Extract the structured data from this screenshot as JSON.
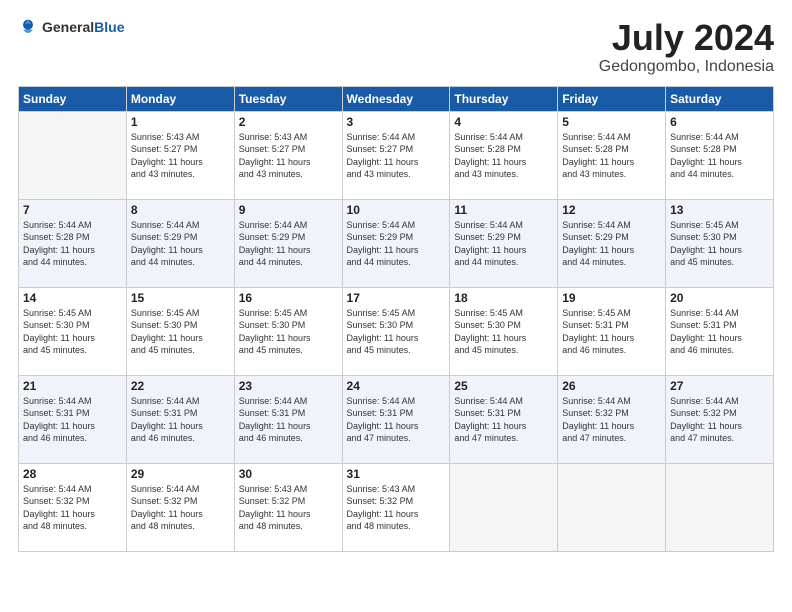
{
  "header": {
    "logo_general": "General",
    "logo_blue": "Blue",
    "title": "July 2024",
    "subtitle": "Gedongombo, Indonesia"
  },
  "days_of_week": [
    "Sunday",
    "Monday",
    "Tuesday",
    "Wednesday",
    "Thursday",
    "Friday",
    "Saturday"
  ],
  "weeks": [
    {
      "days": [
        {
          "num": "",
          "sunrise": "",
          "sunset": "",
          "daylight": "",
          "minutes": ""
        },
        {
          "num": "1",
          "sunrise": "Sunrise: 5:43 AM",
          "sunset": "Sunset: 5:27 PM",
          "daylight": "Daylight: 11 hours",
          "minutes": "and 43 minutes."
        },
        {
          "num": "2",
          "sunrise": "Sunrise: 5:43 AM",
          "sunset": "Sunset: 5:27 PM",
          "daylight": "Daylight: 11 hours",
          "minutes": "and 43 minutes."
        },
        {
          "num": "3",
          "sunrise": "Sunrise: 5:44 AM",
          "sunset": "Sunset: 5:27 PM",
          "daylight": "Daylight: 11 hours",
          "minutes": "and 43 minutes."
        },
        {
          "num": "4",
          "sunrise": "Sunrise: 5:44 AM",
          "sunset": "Sunset: 5:28 PM",
          "daylight": "Daylight: 11 hours",
          "minutes": "and 43 minutes."
        },
        {
          "num": "5",
          "sunrise": "Sunrise: 5:44 AM",
          "sunset": "Sunset: 5:28 PM",
          "daylight": "Daylight: 11 hours",
          "minutes": "and 43 minutes."
        },
        {
          "num": "6",
          "sunrise": "Sunrise: 5:44 AM",
          "sunset": "Sunset: 5:28 PM",
          "daylight": "Daylight: 11 hours",
          "minutes": "and 44 minutes."
        }
      ]
    },
    {
      "days": [
        {
          "num": "7",
          "sunrise": "Sunrise: 5:44 AM",
          "sunset": "Sunset: 5:28 PM",
          "daylight": "Daylight: 11 hours",
          "minutes": "and 44 minutes."
        },
        {
          "num": "8",
          "sunrise": "Sunrise: 5:44 AM",
          "sunset": "Sunset: 5:29 PM",
          "daylight": "Daylight: 11 hours",
          "minutes": "and 44 minutes."
        },
        {
          "num": "9",
          "sunrise": "Sunrise: 5:44 AM",
          "sunset": "Sunset: 5:29 PM",
          "daylight": "Daylight: 11 hours",
          "minutes": "and 44 minutes."
        },
        {
          "num": "10",
          "sunrise": "Sunrise: 5:44 AM",
          "sunset": "Sunset: 5:29 PM",
          "daylight": "Daylight: 11 hours",
          "minutes": "and 44 minutes."
        },
        {
          "num": "11",
          "sunrise": "Sunrise: 5:44 AM",
          "sunset": "Sunset: 5:29 PM",
          "daylight": "Daylight: 11 hours",
          "minutes": "and 44 minutes."
        },
        {
          "num": "12",
          "sunrise": "Sunrise: 5:44 AM",
          "sunset": "Sunset: 5:29 PM",
          "daylight": "Daylight: 11 hours",
          "minutes": "and 44 minutes."
        },
        {
          "num": "13",
          "sunrise": "Sunrise: 5:45 AM",
          "sunset": "Sunset: 5:30 PM",
          "daylight": "Daylight: 11 hours",
          "minutes": "and 45 minutes."
        }
      ]
    },
    {
      "days": [
        {
          "num": "14",
          "sunrise": "Sunrise: 5:45 AM",
          "sunset": "Sunset: 5:30 PM",
          "daylight": "Daylight: 11 hours",
          "minutes": "and 45 minutes."
        },
        {
          "num": "15",
          "sunrise": "Sunrise: 5:45 AM",
          "sunset": "Sunset: 5:30 PM",
          "daylight": "Daylight: 11 hours",
          "minutes": "and 45 minutes."
        },
        {
          "num": "16",
          "sunrise": "Sunrise: 5:45 AM",
          "sunset": "Sunset: 5:30 PM",
          "daylight": "Daylight: 11 hours",
          "minutes": "and 45 minutes."
        },
        {
          "num": "17",
          "sunrise": "Sunrise: 5:45 AM",
          "sunset": "Sunset: 5:30 PM",
          "daylight": "Daylight: 11 hours",
          "minutes": "and 45 minutes."
        },
        {
          "num": "18",
          "sunrise": "Sunrise: 5:45 AM",
          "sunset": "Sunset: 5:30 PM",
          "daylight": "Daylight: 11 hours",
          "minutes": "and 45 minutes."
        },
        {
          "num": "19",
          "sunrise": "Sunrise: 5:45 AM",
          "sunset": "Sunset: 5:31 PM",
          "daylight": "Daylight: 11 hours",
          "minutes": "and 46 minutes."
        },
        {
          "num": "20",
          "sunrise": "Sunrise: 5:44 AM",
          "sunset": "Sunset: 5:31 PM",
          "daylight": "Daylight: 11 hours",
          "minutes": "and 46 minutes."
        }
      ]
    },
    {
      "days": [
        {
          "num": "21",
          "sunrise": "Sunrise: 5:44 AM",
          "sunset": "Sunset: 5:31 PM",
          "daylight": "Daylight: 11 hours",
          "minutes": "and 46 minutes."
        },
        {
          "num": "22",
          "sunrise": "Sunrise: 5:44 AM",
          "sunset": "Sunset: 5:31 PM",
          "daylight": "Daylight: 11 hours",
          "minutes": "and 46 minutes."
        },
        {
          "num": "23",
          "sunrise": "Sunrise: 5:44 AM",
          "sunset": "Sunset: 5:31 PM",
          "daylight": "Daylight: 11 hours",
          "minutes": "and 46 minutes."
        },
        {
          "num": "24",
          "sunrise": "Sunrise: 5:44 AM",
          "sunset": "Sunset: 5:31 PM",
          "daylight": "Daylight: 11 hours",
          "minutes": "and 47 minutes."
        },
        {
          "num": "25",
          "sunrise": "Sunrise: 5:44 AM",
          "sunset": "Sunset: 5:31 PM",
          "daylight": "Daylight: 11 hours",
          "minutes": "and 47 minutes."
        },
        {
          "num": "26",
          "sunrise": "Sunrise: 5:44 AM",
          "sunset": "Sunset: 5:32 PM",
          "daylight": "Daylight: 11 hours",
          "minutes": "and 47 minutes."
        },
        {
          "num": "27",
          "sunrise": "Sunrise: 5:44 AM",
          "sunset": "Sunset: 5:32 PM",
          "daylight": "Daylight: 11 hours",
          "minutes": "and 47 minutes."
        }
      ]
    },
    {
      "days": [
        {
          "num": "28",
          "sunrise": "Sunrise: 5:44 AM",
          "sunset": "Sunset: 5:32 PM",
          "daylight": "Daylight: 11 hours",
          "minutes": "and 48 minutes."
        },
        {
          "num": "29",
          "sunrise": "Sunrise: 5:44 AM",
          "sunset": "Sunset: 5:32 PM",
          "daylight": "Daylight: 11 hours",
          "minutes": "and 48 minutes."
        },
        {
          "num": "30",
          "sunrise": "Sunrise: 5:43 AM",
          "sunset": "Sunset: 5:32 PM",
          "daylight": "Daylight: 11 hours",
          "minutes": "and 48 minutes."
        },
        {
          "num": "31",
          "sunrise": "Sunrise: 5:43 AM",
          "sunset": "Sunset: 5:32 PM",
          "daylight": "Daylight: 11 hours",
          "minutes": "and 48 minutes."
        },
        {
          "num": "",
          "sunrise": "",
          "sunset": "",
          "daylight": "",
          "minutes": ""
        },
        {
          "num": "",
          "sunrise": "",
          "sunset": "",
          "daylight": "",
          "minutes": ""
        },
        {
          "num": "",
          "sunrise": "",
          "sunset": "",
          "daylight": "",
          "minutes": ""
        }
      ]
    }
  ]
}
